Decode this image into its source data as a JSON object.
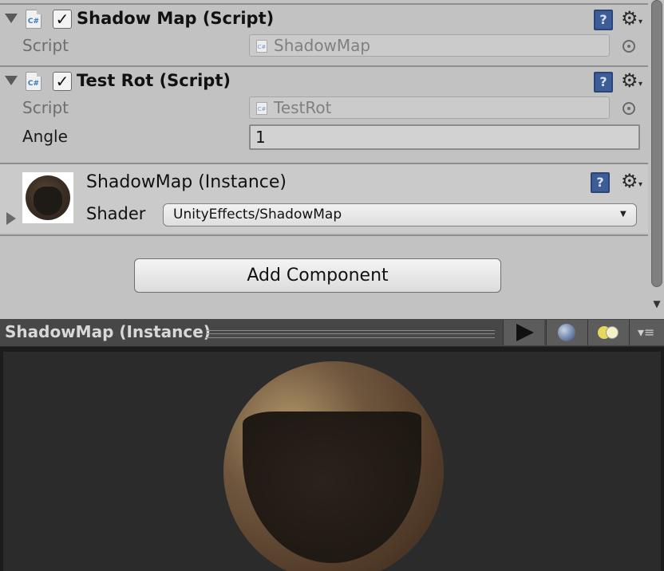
{
  "components": [
    {
      "title": "Shadow Map (Script)",
      "enabled": true,
      "props": [
        {
          "label": "Script",
          "value": "ShadowMap"
        }
      ]
    },
    {
      "title": "Test Rot (Script)",
      "enabled": true,
      "props": [
        {
          "label": "Script",
          "value": "TestRot"
        },
        {
          "label": "Angle",
          "value": "1"
        }
      ]
    }
  ],
  "material": {
    "title": "ShadowMap (Instance)",
    "shader_label": "Shader",
    "shader_value": "UnityEffects/ShadowMap"
  },
  "add_component_label": "Add Component",
  "preview": {
    "title": "ShadowMap (Instance)"
  },
  "icons": {
    "script": "csharp-script-icon",
    "help": "help-book-icon",
    "settings": "gear-icon",
    "object_picker": "target-icon",
    "play": "play-icon",
    "preview_mesh": "sphere-icon",
    "lighting": "light-icon",
    "menu": "menu-icon"
  },
  "colors": {
    "inspector_bg": "#c2c2c2",
    "preview_bg": "#2b2b2b",
    "help_blue": "#3e5d97"
  }
}
